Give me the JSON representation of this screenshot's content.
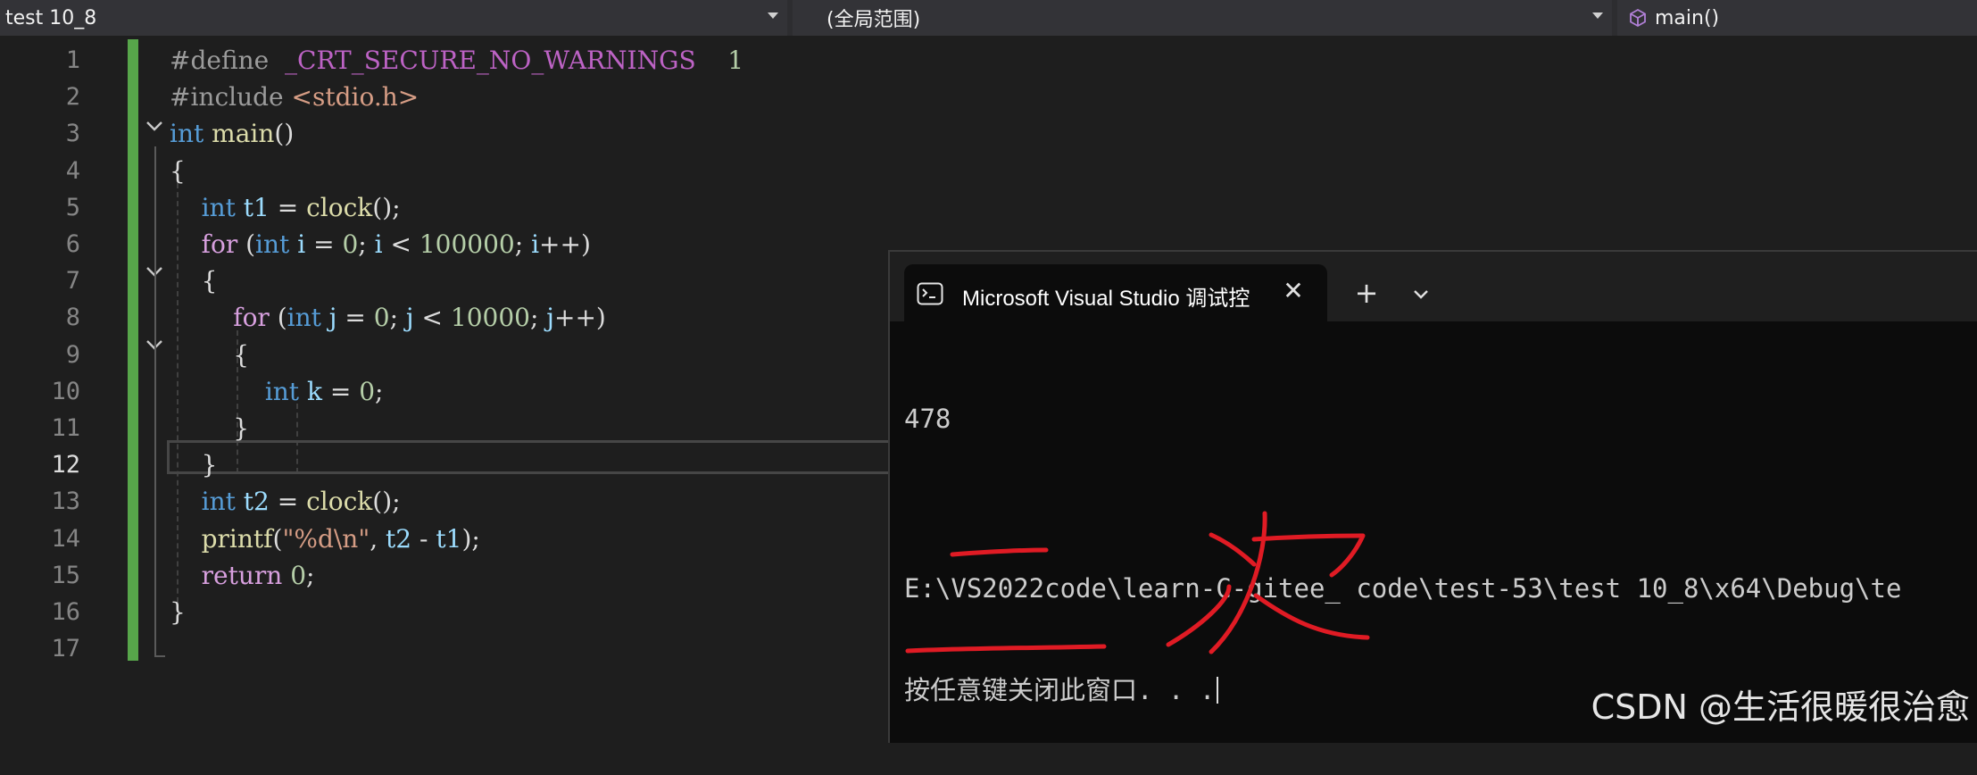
{
  "navbar": {
    "project": "test 10_8",
    "scope": "(全局范围)",
    "member": "main()"
  },
  "editor": {
    "line_numbers": [
      "1",
      "2",
      "3",
      "4",
      "5",
      "6",
      "7",
      "8",
      "9",
      "10",
      "11",
      "12",
      "13",
      "14",
      "15",
      "16",
      "17"
    ],
    "current_line": "12",
    "lines": [
      [
        {
          "t": "#define",
          "c": "pp"
        },
        {
          "t": "  "
        },
        {
          "t": "_CRT_SECURE_NO_WARNINGS",
          "c": "mac"
        },
        {
          "t": "    "
        },
        {
          "t": "1",
          "c": "num"
        }
      ],
      [
        {
          "t": "#include",
          "c": "pp"
        },
        {
          "t": " "
        },
        {
          "t": "<stdio.h>",
          "c": "str"
        }
      ],
      [
        {
          "t": "int",
          "c": "kw"
        },
        {
          "t": " "
        },
        {
          "t": "main",
          "c": "fn"
        },
        {
          "t": "()"
        }
      ],
      [
        {
          "t": "{"
        }
      ],
      [
        {
          "t": "    "
        },
        {
          "t": "int",
          "c": "kw"
        },
        {
          "t": " "
        },
        {
          "t": "t1",
          "c": "var"
        },
        {
          "t": " = "
        },
        {
          "t": "clock",
          "c": "fn"
        },
        {
          "t": "();"
        }
      ],
      [
        {
          "t": "    "
        },
        {
          "t": "for",
          "c": "ctl"
        },
        {
          "t": " ("
        },
        {
          "t": "int",
          "c": "kw"
        },
        {
          "t": " "
        },
        {
          "t": "i",
          "c": "var"
        },
        {
          "t": " = "
        },
        {
          "t": "0",
          "c": "num"
        },
        {
          "t": "; "
        },
        {
          "t": "i",
          "c": "var"
        },
        {
          "t": " < "
        },
        {
          "t": "100000",
          "c": "num"
        },
        {
          "t": "; "
        },
        {
          "t": "i",
          "c": "var"
        },
        {
          "t": "++)"
        }
      ],
      [
        {
          "t": "    {"
        }
      ],
      [
        {
          "t": "        "
        },
        {
          "t": "for",
          "c": "ctl"
        },
        {
          "t": " ("
        },
        {
          "t": "int",
          "c": "kw"
        },
        {
          "t": " "
        },
        {
          "t": "j",
          "c": "var"
        },
        {
          "t": " = "
        },
        {
          "t": "0",
          "c": "num"
        },
        {
          "t": "; "
        },
        {
          "t": "j",
          "c": "var"
        },
        {
          "t": " < "
        },
        {
          "t": "10000",
          "c": "num"
        },
        {
          "t": "; "
        },
        {
          "t": "j",
          "c": "var"
        },
        {
          "t": "++)"
        }
      ],
      [
        {
          "t": "        {"
        }
      ],
      [
        {
          "t": "            "
        },
        {
          "t": "int",
          "c": "kw"
        },
        {
          "t": " "
        },
        {
          "t": "k",
          "c": "var"
        },
        {
          "t": " = "
        },
        {
          "t": "0",
          "c": "num"
        },
        {
          "t": ";"
        }
      ],
      [
        {
          "t": "        }"
        }
      ],
      [
        {
          "t": "    }"
        }
      ],
      [
        {
          "t": "    "
        },
        {
          "t": "int",
          "c": "kw"
        },
        {
          "t": " "
        },
        {
          "t": "t2",
          "c": "var"
        },
        {
          "t": " = "
        },
        {
          "t": "clock",
          "c": "fn"
        },
        {
          "t": "();"
        }
      ],
      [
        {
          "t": "    "
        },
        {
          "t": "printf",
          "c": "fn"
        },
        {
          "t": "("
        },
        {
          "t": "\"%d\\n\"",
          "c": "str"
        },
        {
          "t": ", "
        },
        {
          "t": "t2",
          "c": "var"
        },
        {
          "t": " - "
        },
        {
          "t": "t1",
          "c": "var"
        },
        {
          "t": ");"
        }
      ],
      [
        {
          "t": "    "
        },
        {
          "t": "return",
          "c": "ctl"
        },
        {
          "t": " "
        },
        {
          "t": "0",
          "c": "num"
        },
        {
          "t": ";"
        }
      ],
      [
        {
          "t": "}"
        }
      ],
      []
    ]
  },
  "console": {
    "tab_title": "Microsoft Visual Studio 调试控",
    "new_tab_glyph": "+",
    "close_glyph": "✕",
    "output_lines": [
      "478",
      "",
      "E:\\VS2022code\\learn-C-gitee_ code\\test-53\\test 10_8\\x64\\Debug\\te",
      "按任意键关闭此窗口. . ."
    ],
    "handwriting": "二次",
    "ink_color": "#e01b24"
  },
  "watermark": "CSDN @生活很暖很治愈"
}
